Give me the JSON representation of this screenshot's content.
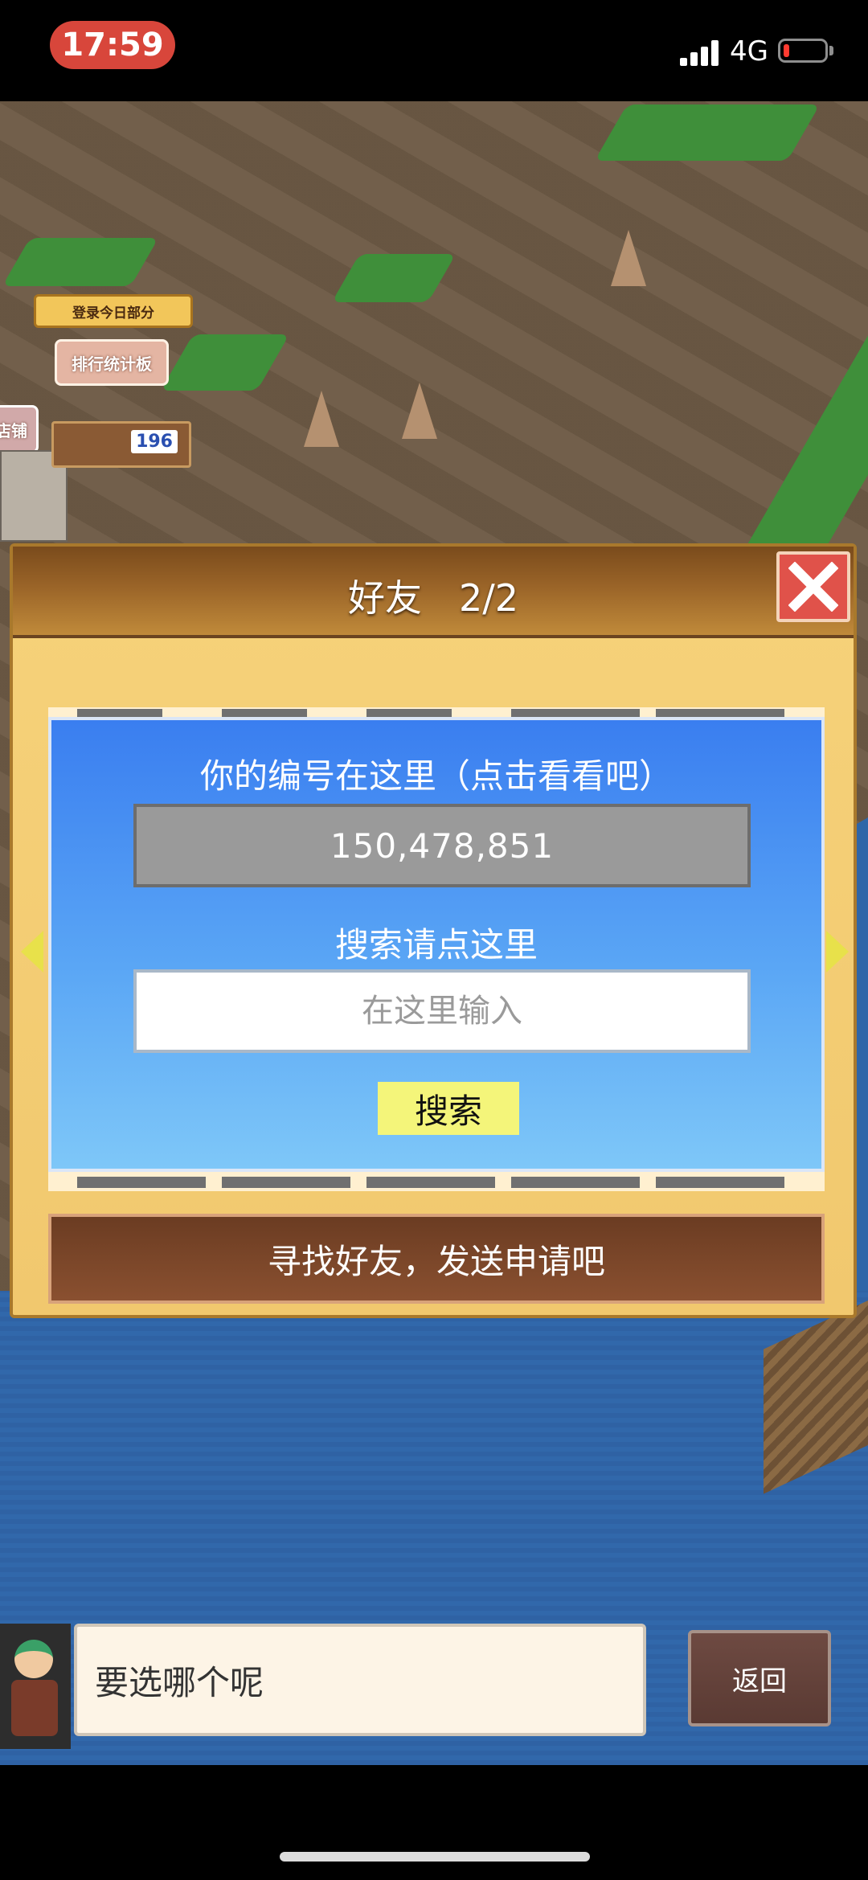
{
  "status_bar": {
    "time": "17:59",
    "network": "4G",
    "battery_level": 0.15
  },
  "world": {
    "sign_login": "登录今日部分",
    "sign_rank": "排行统计板",
    "sign_shop": "店铺",
    "sign_count": "196"
  },
  "dialog": {
    "title": "好友　2/2",
    "id_label": "你的编号在这里（点击看看吧）",
    "id_value": "150,478,851",
    "search_label": "搜索请点这里",
    "search_placeholder": "在这里输入",
    "search_button": "搜索",
    "find_button": "寻找好友，发送申请吧"
  },
  "bottom": {
    "message": "要选哪个呢",
    "back_button": "返回"
  },
  "colors": {
    "accent_blue": "#3a7ef0",
    "close_red": "#e0524a",
    "search_yellow": "#f4f57a",
    "wood_brown": "#7a4b1c"
  }
}
